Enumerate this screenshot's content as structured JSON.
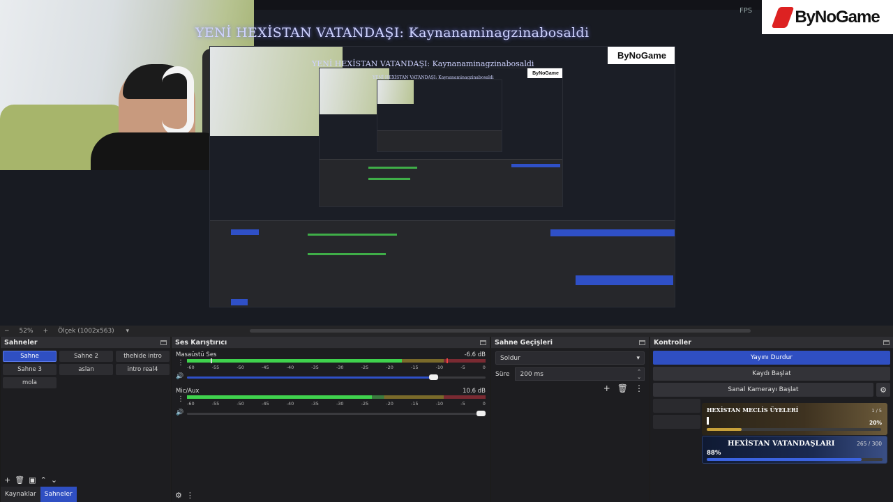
{
  "preview": {
    "banner": "YENİ HEXİSTAN VATANDAŞI: Kaynanaminagzinabosaldi",
    "fps": "FPS",
    "logo": "ByNoGame"
  },
  "zoombar": {
    "zoom": "52%",
    "scale": "Ölçek (1002x563)"
  },
  "scenes": {
    "title": "Sahneler",
    "items": [
      "Sahne",
      "Sahne 2",
      "thehide intro",
      "Sahne 3",
      "aslan",
      "intro real4",
      "mola"
    ],
    "active": "Sahne",
    "tabs": [
      "Kaynaklar",
      "Sahneler"
    ],
    "active_tab": "Sahneler"
  },
  "mixer": {
    "title": "Ses Karıştırıcı",
    "channels": [
      {
        "name": "Masaüstü Ses",
        "db": "-6.6 dB",
        "level": 0.72,
        "volume": 0.84
      },
      {
        "name": "Mic/Aux",
        "db": "10.6 dB",
        "level": 0.62,
        "volume": 1.0
      }
    ],
    "scale": [
      "-60",
      "-55",
      "-50",
      "-45",
      "-40",
      "-35",
      "-30",
      "-25",
      "-20",
      "-15",
      "-10",
      "-5",
      "0"
    ]
  },
  "transitions": {
    "title": "Sahne Geçişleri",
    "selected": "Soldur",
    "duration_label": "Süre",
    "duration_value": "200 ms"
  },
  "controls": {
    "title": "Kontroller",
    "stop_stream": "Yayını Durdur",
    "start_recording": "Kaydı Başlat",
    "virtual_cam": "Sanal Kamerayı Başlat"
  },
  "cards": {
    "meclis": {
      "title": "HEXİSTAN MECLİS ÜYELERİ",
      "count": "1 / 5",
      "percent": "20%",
      "value": 0.2,
      "accent": "#c8a13a"
    },
    "vatandas": {
      "title": "HEXİSTAN VATANDAŞLARI",
      "count": "265 / 300",
      "percent": "88%",
      "value": 0.88,
      "accent": "#3b63e0"
    }
  }
}
